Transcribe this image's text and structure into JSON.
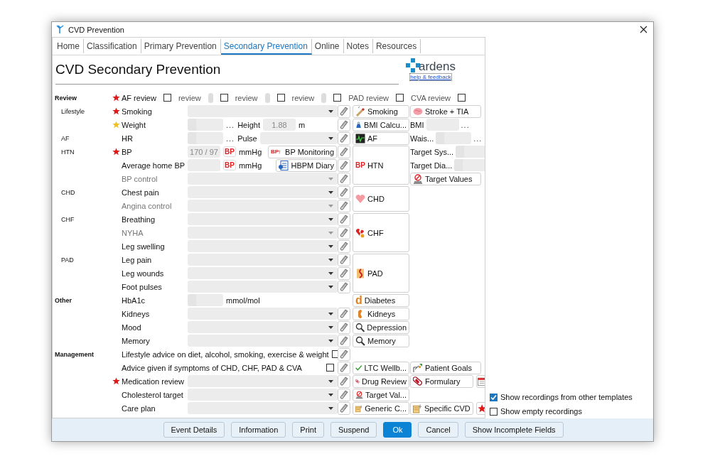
{
  "window": {
    "title": "CVD Prevention"
  },
  "tabs": [
    {
      "label": "Home",
      "selected": false
    },
    {
      "label": "Classification",
      "selected": false
    },
    {
      "label": "Primary Prevention",
      "selected": false
    },
    {
      "label": "Secondary Prevention",
      "selected": true
    },
    {
      "label": "Online",
      "selected": false
    },
    {
      "label": "Notes",
      "selected": false
    },
    {
      "label": "Resources",
      "selected": false
    }
  ],
  "heading": "CVD Secondary Prevention",
  "logo": {
    "name": "ardens",
    "link": "help & feedback"
  },
  "groups": [
    {
      "heading": "Review",
      "rows": [
        {
          "kind": "review",
          "color": "#e01818",
          "items": [
            {
              "kind": "text",
              "text": "AF review"
            },
            {
              "kind": "checkbox",
              "checked": false
            },
            {
              "kind": "faint",
              "text": "review"
            },
            {
              "kind": "stub"
            },
            {
              "kind": "checkbox",
              "checked": false
            },
            {
              "kind": "faint",
              "text": "review"
            },
            {
              "kind": "stub"
            },
            {
              "kind": "checkbox",
              "checked": false
            },
            {
              "kind": "faint",
              "text": "review"
            },
            {
              "kind": "stub"
            },
            {
              "kind": "checkbox",
              "checked": false
            },
            {
              "kind": "faint",
              "text": "PAD review"
            },
            {
              "kind": "checkbox",
              "checked": false
            },
            {
              "kind": "faint",
              "text": "CVA review"
            },
            {
              "kind": "checkbox",
              "checked": false
            }
          ]
        }
      ],
      "children": [
        {
          "heading": "Lifestyle",
          "rows": [
            {
              "kind": "entry",
              "color": "#e01818",
              "label": "Smoking",
              "disabled": false,
              "edit": true,
              "items": [
                {
                  "kind": "select"
                }
              ],
              "button_a": {
                "kind": "cigarette",
                "label": "Smoking"
              },
              "side": [
                {
                  "kind": "stroke",
                  "label": "Stroke + TIA"
                }
              ]
            },
            {
              "kind": "entry",
              "color": "#f0c020",
              "label": "Weight",
              "disabled": false,
              "edit": true,
              "items": [
                {
                  "kind": "split-field"
                },
                {
                  "kind": "more",
                  "text": "..."
                },
                {
                  "kind": "text",
                  "text": "Height"
                },
                {
                  "kind": "field",
                  "value": "1.88"
                },
                {
                  "kind": "text",
                  "text": "m"
                }
              ],
              "button_a": {
                "kind": "bmi",
                "label": "BMI Calcu..."
              },
              "side": [
                {
                  "kind": "text",
                  "text": "BMI"
                },
                {
                  "kind": "field"
                },
                {
                  "kind": "more",
                  "text": "..."
                }
              ]
            }
          ]
        },
        {
          "heading": "AF",
          "rows": [
            {
              "kind": "entry",
              "label": "HR",
              "disabled": false,
              "edit": true,
              "items": [
                {
                  "kind": "split-field"
                },
                {
                  "kind": "more",
                  "text": "..."
                },
                {
                  "kind": "text",
                  "text": "Pulse"
                },
                {
                  "kind": "select"
                }
              ],
              "button_a": {
                "kind": "af",
                "label": "AF"
              },
              "side": [
                {
                  "kind": "text",
                  "text": "Wais..."
                },
                {
                  "kind": "split-field"
                },
                {
                  "kind": "more",
                  "text": "..."
                }
              ]
            }
          ]
        },
        {
          "heading": "HTN",
          "tile": {
            "kind": "htn",
            "badge": "BP",
            "label": "HTN"
          },
          "rows": [
            {
              "kind": "entry",
              "color": "#e01818",
              "label": "BP",
              "disabled": false,
              "edit": true,
              "items": [
                {
                  "kind": "field",
                  "value": "170 / 97"
                },
                {
                  "kind": "badge",
                  "text": "BP"
                },
                {
                  "kind": "text",
                  "text": "mmHg"
                },
                {
                  "kind": "bp-monitoring",
                  "badge": "BP",
                  "label": "BP Monitoring"
                }
              ],
              "side": [
                {
                  "kind": "text",
                  "text": "Target Sys..."
                },
                {
                  "kind": "split-field"
                }
              ]
            },
            {
              "kind": "entry",
              "label": "Average home BP",
              "disabled": false,
              "edit": true,
              "items": [
                {
                  "kind": "field"
                },
                {
                  "kind": "badge",
                  "text": "BP"
                },
                {
                  "kind": "text",
                  "text": "mmHg"
                },
                {
                  "kind": "diary",
                  "label": "HBPM Diary"
                }
              ],
              "side": [
                {
                  "kind": "text",
                  "text": "Target Dia..."
                },
                {
                  "kind": "split-field"
                }
              ]
            },
            {
              "kind": "entry",
              "label": "BP control",
              "disabled": true,
              "edit": true,
              "items": [
                {
                  "kind": "select"
                }
              ],
              "side": [
                {
                  "kind": "target",
                  "label": "Target Values"
                }
              ]
            }
          ]
        },
        {
          "heading": "CHD",
          "tile": {
            "kind": "heart",
            "label": "CHD"
          },
          "rows": [
            {
              "kind": "entry",
              "label": "Chest pain",
              "disabled": false,
              "edit": true,
              "items": [
                {
                  "kind": "select"
                }
              ]
            },
            {
              "kind": "entry",
              "label": "Angina control",
              "disabled": true,
              "edit": true,
              "items": [
                {
                  "kind": "select"
                }
              ]
            }
          ]
        },
        {
          "heading": "CHF",
          "tile": {
            "kind": "broken-heart",
            "label": "CHF"
          },
          "rows": [
            {
              "kind": "entry",
              "label": "Breathing",
              "disabled": false,
              "edit": true,
              "items": [
                {
                  "kind": "select"
                }
              ]
            },
            {
              "kind": "entry",
              "label": "NYHA",
              "disabled": true,
              "edit": true,
              "items": [
                {
                  "kind": "select"
                }
              ]
            },
            {
              "kind": "entry",
              "label": "Leg swelling",
              "disabled": false,
              "edit": true,
              "items": [
                {
                  "kind": "select"
                }
              ]
            }
          ]
        },
        {
          "heading": "PAD",
          "tile": {
            "kind": "pad",
            "label": "PAD"
          },
          "rows": [
            {
              "kind": "entry",
              "label": "Leg pain",
              "disabled": false,
              "edit": true,
              "items": [
                {
                  "kind": "select"
                }
              ]
            },
            {
              "kind": "entry",
              "label": "Leg wounds",
              "disabled": false,
              "edit": true,
              "items": [
                {
                  "kind": "select"
                }
              ]
            },
            {
              "kind": "entry",
              "label": "Foot pulses",
              "disabled": false,
              "edit": true,
              "items": [
                {
                  "kind": "select"
                }
              ]
            }
          ]
        }
      ]
    },
    {
      "heading": "Other",
      "rows": [
        {
          "kind": "entry",
          "label": "HbA1c",
          "disabled": false,
          "edit": false,
          "items": [
            {
              "kind": "split-field"
            },
            {
              "kind": "text",
              "text": "mmol/mol"
            }
          ],
          "button_a": {
            "kind": "diabetes",
            "badge": "d",
            "label": "Diabetes"
          }
        },
        {
          "kind": "entry",
          "label": "Kidneys",
          "disabled": false,
          "edit": true,
          "items": [
            {
              "kind": "select"
            }
          ],
          "button_a": {
            "kind": "kidney",
            "label": "Kidneys"
          }
        },
        {
          "kind": "entry",
          "label": "Mood",
          "disabled": false,
          "edit": true,
          "items": [
            {
              "kind": "select"
            }
          ],
          "button_a": {
            "kind": "magnifier",
            "label": "Depression"
          }
        },
        {
          "kind": "entry",
          "label": "Memory",
          "disabled": false,
          "edit": true,
          "items": [
            {
              "kind": "select"
            }
          ],
          "button_a": {
            "kind": "magnifier",
            "label": "Memory"
          }
        }
      ]
    },
    {
      "heading": "Management",
      "rows": [
        {
          "kind": "check",
          "label": "Lifestyle advice on diet, alcohol, smoking, exercise & weight",
          "checked": false,
          "edit": true
        },
        {
          "kind": "check",
          "label": "Advice given if symptoms of CHD, CHF, PAD & CVA",
          "checked": false,
          "edit": true,
          "button_a": {
            "kind": "tick",
            "label": "LTC Wellb..."
          },
          "side": [
            {
              "kind": "goals",
              "label": "Patient Goals"
            }
          ]
        },
        {
          "kind": "entry",
          "color": "#e01818",
          "label": "Medication review",
          "disabled": false,
          "edit": true,
          "items": [
            {
              "kind": "select"
            }
          ],
          "button_a": {
            "kind": "pill",
            "label": "Drug Review"
          },
          "side": [
            {
              "kind": "pill",
              "label": "Formulary"
            },
            {
              "kind": "calendar"
            }
          ]
        },
        {
          "kind": "entry",
          "label": "Cholesterol target",
          "disabled": false,
          "edit": true,
          "items": [
            {
              "kind": "select"
            }
          ],
          "button_a": {
            "kind": "target",
            "label": "Target Val..."
          }
        },
        {
          "kind": "entry",
          "label": "Care plan",
          "disabled": false,
          "edit": true,
          "items": [
            {
              "kind": "select"
            }
          ],
          "button_a": {
            "kind": "document",
            "label": "Generic C..."
          },
          "side": [
            {
              "kind": "document",
              "label": "Specific CVD"
            },
            {
              "kind": "star"
            }
          ]
        }
      ]
    }
  ],
  "options": [
    {
      "label": "Show recordings from other templates",
      "checked": true
    },
    {
      "label": "Show empty recordings",
      "checked": false
    }
  ],
  "buttons": [
    {
      "label": "Event Details",
      "primary": false
    },
    {
      "label": "Information",
      "primary": false
    },
    {
      "label": "Print",
      "primary": false
    },
    {
      "label": "Suspend",
      "primary": false
    },
    {
      "label": "Ok",
      "primary": true
    },
    {
      "label": "Cancel",
      "primary": false
    },
    {
      "label": "Show Incomplete Fields",
      "primary": false
    }
  ]
}
